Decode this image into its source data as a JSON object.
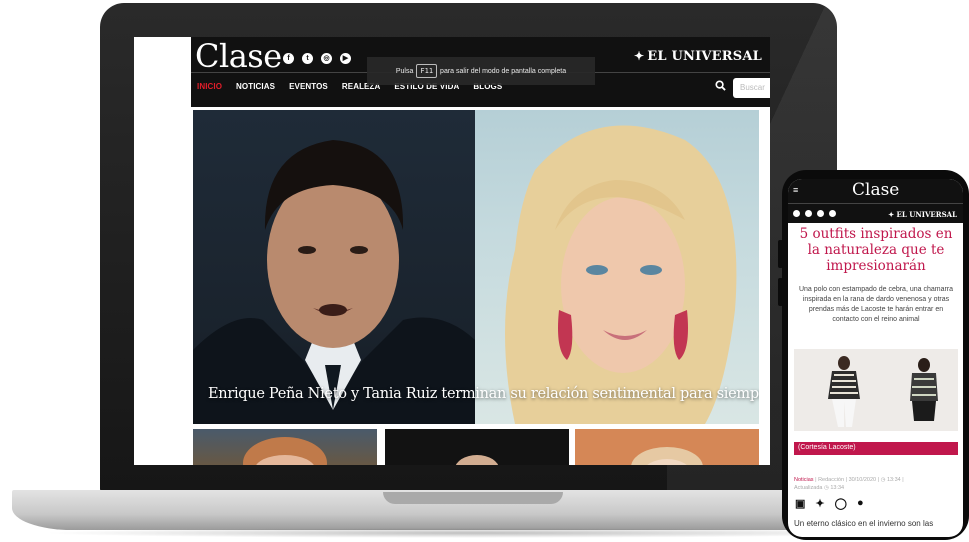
{
  "site": {
    "logo": "Clase",
    "brand": "EL UNIVERSAL",
    "nav": [
      "INICIO",
      "NOTICIAS",
      "EVENTOS",
      "REALEZA",
      "ESTILO DE VIDA",
      "BLOGS"
    ],
    "search_placeholder": "Buscar",
    "accent_color": "#e11d2a"
  },
  "fullscreen_notice": {
    "prefix": "Pulsa",
    "key": "F11",
    "suffix": "para salir del modo de pantalla completa"
  },
  "hero": {
    "headline": "Enrique Peña Nieto y Tania Ruiz terminan su relación sentimental para siempre"
  },
  "mobile": {
    "logo": "Clase",
    "brand": "EL UNIVERSAL",
    "title": "5 outfits inspirados en la naturaleza que te impresionarán",
    "lede": "Una polo con estampado de cebra, una chamarra inspirada en la rana de dardo venenosa y otras prendas más de Lacoste te harán entrar en contacto con el reino animal",
    "photo_caption": "(Cortesía Lacoste)",
    "meta": {
      "section": "Noticias",
      "author": "Redacción",
      "date": "30/10/2020",
      "time": "13:34",
      "updated_label": "Actualizada",
      "updated_time": "13:34"
    },
    "body_start": "Un eterno clásico en el invierno son las",
    "title_color": "#c0174c"
  }
}
